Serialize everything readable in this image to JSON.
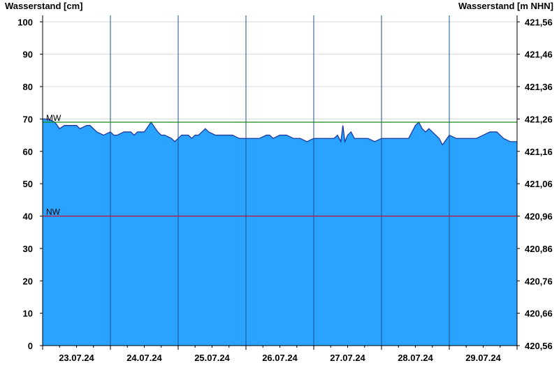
{
  "chart_data": {
    "type": "area",
    "ylabel_left": "Wasserstand [cm]",
    "ylabel_right": "Wasserstand [m NHN]",
    "ylim": [
      0,
      102
    ],
    "yticks": [
      0,
      10,
      20,
      30,
      40,
      50,
      60,
      70,
      80,
      90,
      100
    ],
    "yticks_right": [
      {
        "value": 0,
        "label": "420,56"
      },
      {
        "value": 10,
        "label": "420,66"
      },
      {
        "value": 20,
        "label": "420,76"
      },
      {
        "value": 30,
        "label": "420,86"
      },
      {
        "value": 40,
        "label": "420,96"
      },
      {
        "value": 50,
        "label": "421,06"
      },
      {
        "value": 60,
        "label": "421,16"
      },
      {
        "value": 70,
        "label": "421,26"
      },
      {
        "value": 80,
        "label": "421,36"
      },
      {
        "value": 90,
        "label": "421,46"
      },
      {
        "value": 100,
        "label": "421,56"
      }
    ],
    "xlim": [
      0,
      7
    ],
    "day_labels": [
      "23.07.24",
      "24.07.24",
      "25.07.24",
      "26.07.24",
      "27.07.24",
      "28.07.24",
      "29.07.24"
    ],
    "grid": true,
    "area_color": "#29a3ff",
    "line_color": "#1e3aa0",
    "reference_lines": [
      {
        "label": "MW",
        "value": 69,
        "color": "#138a13"
      },
      {
        "label": "NW",
        "value": 40,
        "color": "#c8102e"
      }
    ],
    "series": [
      {
        "x": [
          0,
          0.08,
          0.18,
          0.25,
          0.32,
          0.4,
          0.5,
          0.55,
          0.65,
          0.7,
          0.8,
          0.9,
          1.0,
          1.05,
          1.1,
          1.2,
          1.3,
          1.35,
          1.4,
          1.5,
          1.6,
          1.7,
          1.75,
          1.8,
          1.9,
          1.95,
          2.0,
          2.05,
          2.1,
          2.15,
          2.2,
          2.25,
          2.3,
          2.35,
          2.4,
          2.45,
          2.55,
          2.6,
          2.7,
          2.8,
          2.9,
          3.0,
          3.1,
          3.2,
          3.3,
          3.35,
          3.4,
          3.5,
          3.6,
          3.7,
          3.8,
          3.9,
          4.0,
          4.05,
          4.1,
          4.2,
          4.3,
          4.35,
          4.4,
          4.43,
          4.46,
          4.5,
          4.55,
          4.6,
          4.7,
          4.8,
          4.9,
          5.0,
          5.1,
          5.2,
          5.3,
          5.4,
          5.45,
          5.5,
          5.55,
          5.6,
          5.65,
          5.7,
          5.8,
          5.85,
          5.9,
          6.0,
          6.1,
          6.2,
          6.3,
          6.4,
          6.5,
          6.6,
          6.65,
          6.7,
          6.8,
          6.9,
          7.0
        ],
        "values": [
          70,
          70,
          69,
          67,
          68,
          68,
          68,
          67,
          68,
          68,
          66,
          65,
          66,
          65,
          65,
          66,
          66,
          65,
          66,
          66,
          69,
          66,
          65,
          65,
          64,
          63,
          64,
          65,
          65,
          65,
          64,
          65,
          65,
          66,
          67,
          66,
          65,
          65,
          65,
          65,
          64,
          64,
          64,
          64,
          65,
          65,
          64,
          65,
          65,
          64,
          64,
          63,
          64,
          64,
          64,
          64,
          64,
          65,
          63,
          68,
          63,
          65,
          66,
          64,
          64,
          64,
          63,
          64,
          64,
          64,
          64,
          64,
          66,
          68,
          69,
          67,
          66,
          67,
          65,
          64,
          62,
          65,
          64,
          64,
          64,
          64,
          65,
          66,
          66,
          66,
          64,
          63,
          63
        ]
      }
    ]
  }
}
